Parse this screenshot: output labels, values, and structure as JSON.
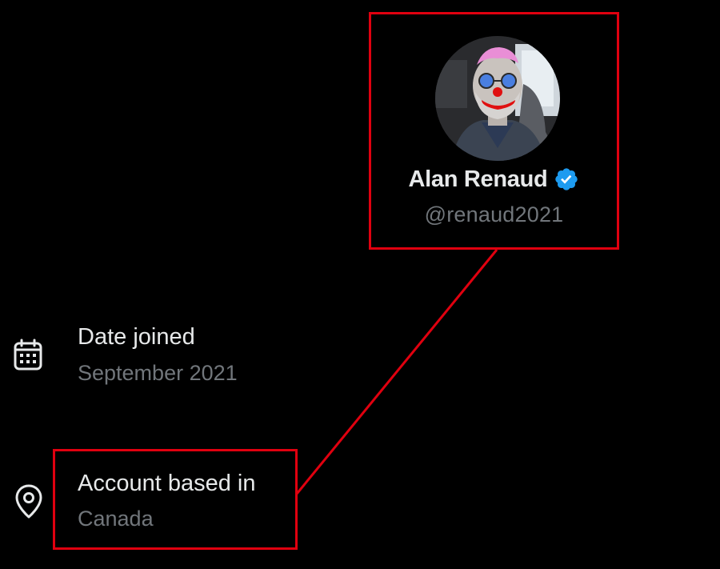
{
  "profile": {
    "display_name": "Alan Renaud",
    "handle": "@renaud2021",
    "verified": true
  },
  "details": {
    "date_joined": {
      "label": "Date joined",
      "value": "September 2021",
      "icon": "calendar-icon"
    },
    "account_location": {
      "label": "Account based in",
      "value": "Canada",
      "icon": "location-pin-icon"
    }
  },
  "colors": {
    "background": "#000000",
    "highlight": "#e0000f",
    "primary_text": "#e7e9ea",
    "secondary_text": "#71767b",
    "verified_badge": "#1d9bf0"
  }
}
